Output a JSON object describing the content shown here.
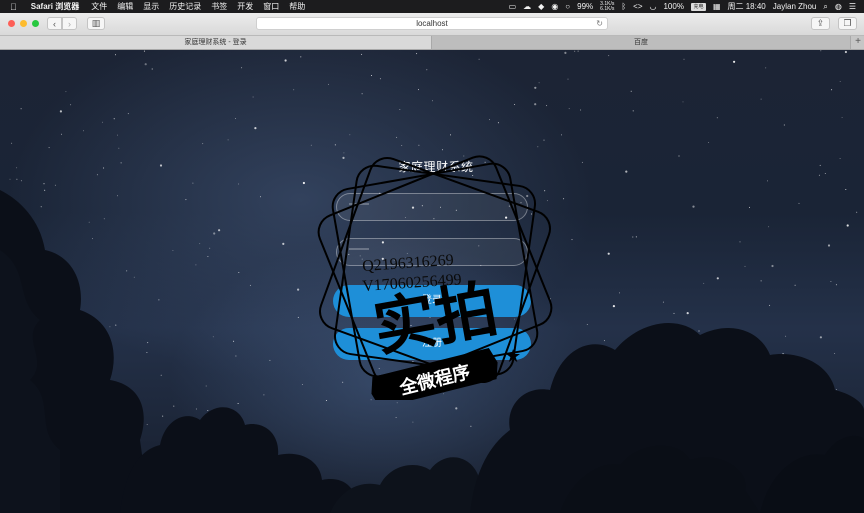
{
  "menubar": {
    "app_name": "Safari 浏览器",
    "menus": [
      "文件",
      "编辑",
      "显示",
      "历史记录",
      "书签",
      "开发",
      "窗口",
      "帮助"
    ],
    "battery_percent": "99%",
    "net_up": "3.1K/s",
    "net_down": "6.1K/s",
    "battery_main": "100%",
    "battery_badge": "充电",
    "clock": "周二 18:40",
    "user": "Jaylan Zhou"
  },
  "browser": {
    "address": "localhost",
    "tabs": [
      "家庭理财系统 - 登录",
      "百度"
    ]
  },
  "page": {
    "title": "家庭理财系统",
    "login_button": "登录",
    "register_button": "注册"
  },
  "watermark": {
    "line1": "Q2196316269",
    "line2": "V17060256499",
    "big_text": "实拍",
    "ribbon_text": "全微程序"
  }
}
